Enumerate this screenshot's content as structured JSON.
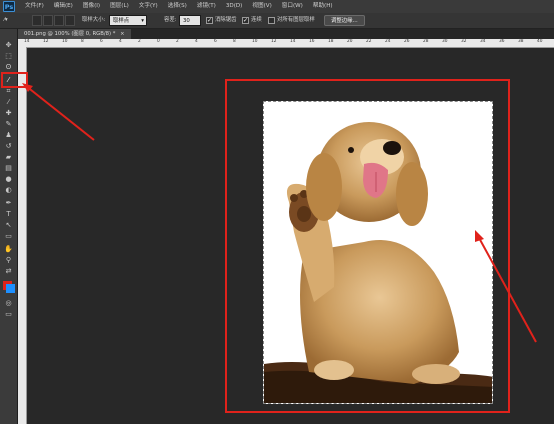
{
  "app": {
    "logo": "Ps"
  },
  "menu": [
    "文件(F)",
    "编辑(E)",
    "图像(I)",
    "图层(L)",
    "文字(Y)",
    "选择(S)",
    "滤镜(T)",
    "3D(D)",
    "视图(V)",
    "窗口(W)",
    "帮助(H)"
  ],
  "options": {
    "sample_size_label": "取样大小:",
    "sample_size_value": "取样点",
    "tolerance_label": "容差:",
    "tolerance_value": "30",
    "antialias_label": "消除锯齿",
    "contiguous_label": "连续",
    "sample_all_label": "对所有图层取样",
    "refine_edge_label": "调整边缘..."
  },
  "document": {
    "tab_label": "001.png @ 100% (图层 0, RGB/8) *"
  },
  "ruler": {
    "top_ticks": [
      "14",
      "12",
      "10",
      "8",
      "6",
      "4",
      "2",
      "0",
      "2",
      "4",
      "6",
      "8",
      "10",
      "12",
      "14",
      "16",
      "18",
      "20",
      "22",
      "24",
      "26",
      "28",
      "30",
      "32",
      "34",
      "36",
      "38",
      "40"
    ]
  },
  "colors": {
    "highlight_red": "#e0221b",
    "foreground": "#e0221b",
    "background": "#1e90ff"
  }
}
